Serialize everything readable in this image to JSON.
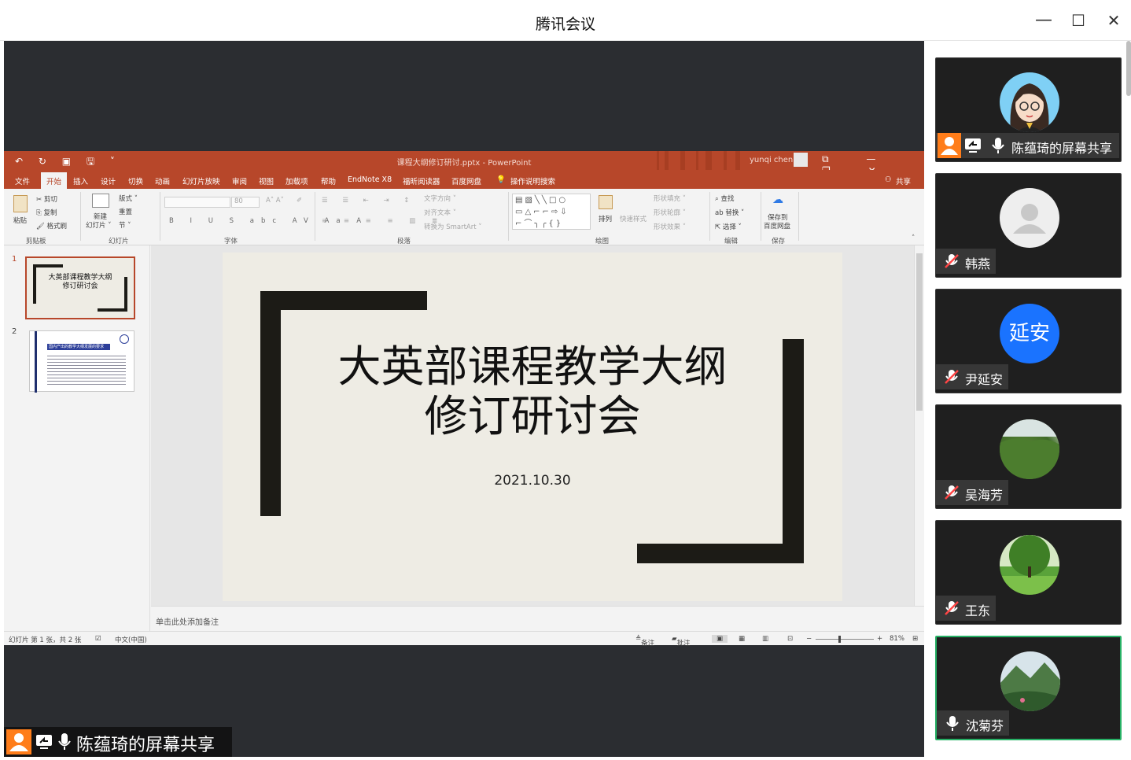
{
  "window": {
    "title": "腾讯会议",
    "minimize": "—",
    "maximize": "☐",
    "close": "✕"
  },
  "ppt": {
    "doc_title": "课程大纲修订研讨.pptx  -  PowerPoint",
    "user": "yunqi chen",
    "tabs": [
      "文件",
      "开始",
      "插入",
      "设计",
      "切换",
      "动画",
      "幻灯片放映",
      "审阅",
      "视图",
      "加载项",
      "帮助",
      "EndNote X8",
      "福昕阅读器",
      "百度网盘",
      "操作说明搜索"
    ],
    "share": "共享",
    "ribbon": {
      "paste": "粘贴",
      "cut": "剪切",
      "copy": "复制",
      "format_painter": "格式刷",
      "clipboard": "剪贴板",
      "new_slide": "新建",
      "new_slide2": "幻灯片 ˅",
      "layout": "版式 ˅",
      "reset": "重置",
      "section": "节 ˅",
      "slides": "幻灯片",
      "font_size": "80",
      "font": "字体",
      "text_direction": "文字方向 ˅",
      "align_text": "对齐文本 ˅",
      "convert_smartart": "转换为 SmartArt ˅",
      "paragraph": "段落",
      "arrange": "排列",
      "quick_styles": "快速样式",
      "shape_fill": "形状填充 ˅",
      "shape_outline": "形状轮廓 ˅",
      "shape_effects": "形状效果 ˅",
      "drawing": "绘图",
      "find": "查找",
      "replace": "替换 ˅",
      "select": "选择 ˅",
      "editing": "编辑",
      "save_to": "保存到",
      "baidu": "百度网盘",
      "save": "保存"
    },
    "thumb_numbers": [
      "1",
      "2"
    ],
    "thumb1_title": "大英部课程教学大纲修订研讨会",
    "thumb2_header": "国内产出的教学大纲发展的要求",
    "slide": {
      "title_line1": "大英部课程教学大纲",
      "title_line2": "修订研讨会",
      "date": "2021.10.30"
    },
    "notes_placeholder": "单击此处添加备注",
    "status": {
      "slide_info": "幻灯片 第 1 张，共 2 张",
      "language": "中文(中国)",
      "notes": "备注",
      "comments": "批注",
      "zoom": "81%"
    }
  },
  "share_label": "陈蕴琦的屏幕共享",
  "participants": [
    {
      "name": "陈蕴琦的屏幕共享",
      "avatar": "cartoon-girl",
      "muted": false,
      "sharing": true
    },
    {
      "name": "韩燕",
      "avatar": "default-person",
      "muted": true
    },
    {
      "name": "尹延安",
      "avatar": "text",
      "avatar_text": "延安",
      "avatar_color": "#1a73ff",
      "muted": true
    },
    {
      "name": "吴海芳",
      "avatar": "grass-photo",
      "muted": true
    },
    {
      "name": "王东",
      "avatar": "tree-photo",
      "muted": true
    },
    {
      "name": "沈菊芬",
      "avatar": "mountain-photo",
      "muted": false,
      "speaking": true
    }
  ],
  "colors": {
    "ppt_accent": "#b7472a",
    "speaking_border": "#27b166",
    "share_orange": "#ff7d1a",
    "avatar_blue": "#1a73ff"
  }
}
